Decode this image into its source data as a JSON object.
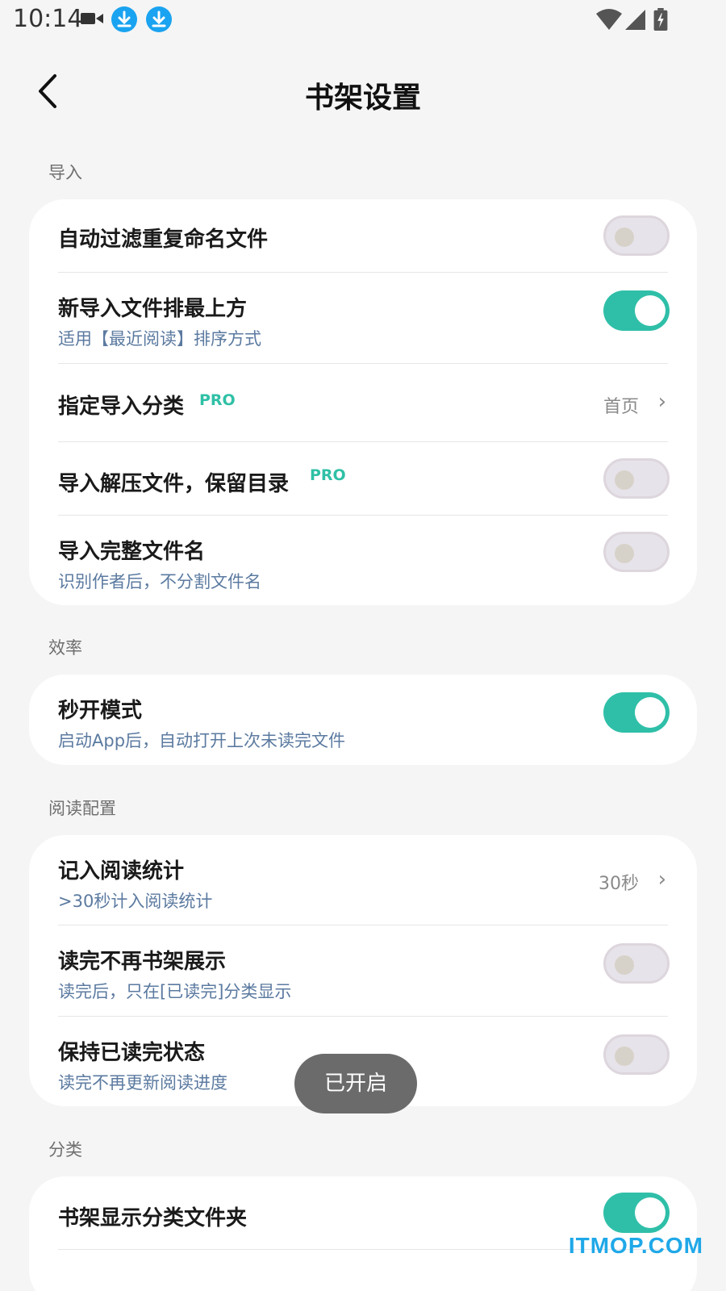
{
  "status_bar": {
    "time": "10:14",
    "icons": [
      "video-icon",
      "download-icon",
      "download-icon",
      "wifi-icon",
      "signal-icon",
      "battery-icon"
    ],
    "download_color": "#1aa3f0"
  },
  "header": {
    "title": "书架设置",
    "back_icon": "back-arrow-icon"
  },
  "sections": {
    "import": {
      "label": "导入",
      "rows": {
        "dedupe": {
          "title": "自动过滤重复命名文件",
          "enabled": false
        },
        "new_on_top": {
          "title": "新导入文件排最上方",
          "subtitle": "适用【最近阅读】排序方式",
          "enabled": true
        },
        "category": {
          "title": "指定导入分类",
          "pro": "PRO",
          "value": "首页"
        },
        "unzip": {
          "title": "导入解压文件，保留目录",
          "pro": "PRO",
          "enabled": false
        },
        "full_name": {
          "title": "导入完整文件名",
          "subtitle": "识别作者后，不分割文件名",
          "enabled": false
        }
      }
    },
    "efficiency": {
      "label": "效率",
      "rows": {
        "instant_open": {
          "title": "秒开模式",
          "subtitle": "启动App后，自动打开上次未读完文件",
          "enabled": true
        }
      }
    },
    "reading": {
      "label": "阅读配置",
      "rows": {
        "stats": {
          "title": "记入阅读统计",
          "subtitle": ">30秒计入阅读统计",
          "value": "30秒"
        },
        "hide_finished": {
          "title": "读完不再书架展示",
          "subtitle": "读完后，只在[已读完]分类显示",
          "enabled": false
        },
        "keep_finished": {
          "title": "保持已读完状态",
          "subtitle": "读完不再更新阅读进度",
          "enabled": false
        }
      }
    },
    "category": {
      "label": "分类",
      "rows": {
        "show_folders": {
          "title": "书架显示分类文件夹",
          "enabled": true
        }
      }
    }
  },
  "toast": {
    "text": "已开启"
  },
  "watermark": "ITMOP.COM",
  "colors": {
    "accent": "#2fbfa8",
    "subtitle": "#5b7aa0",
    "background": "#f5f5f5"
  }
}
